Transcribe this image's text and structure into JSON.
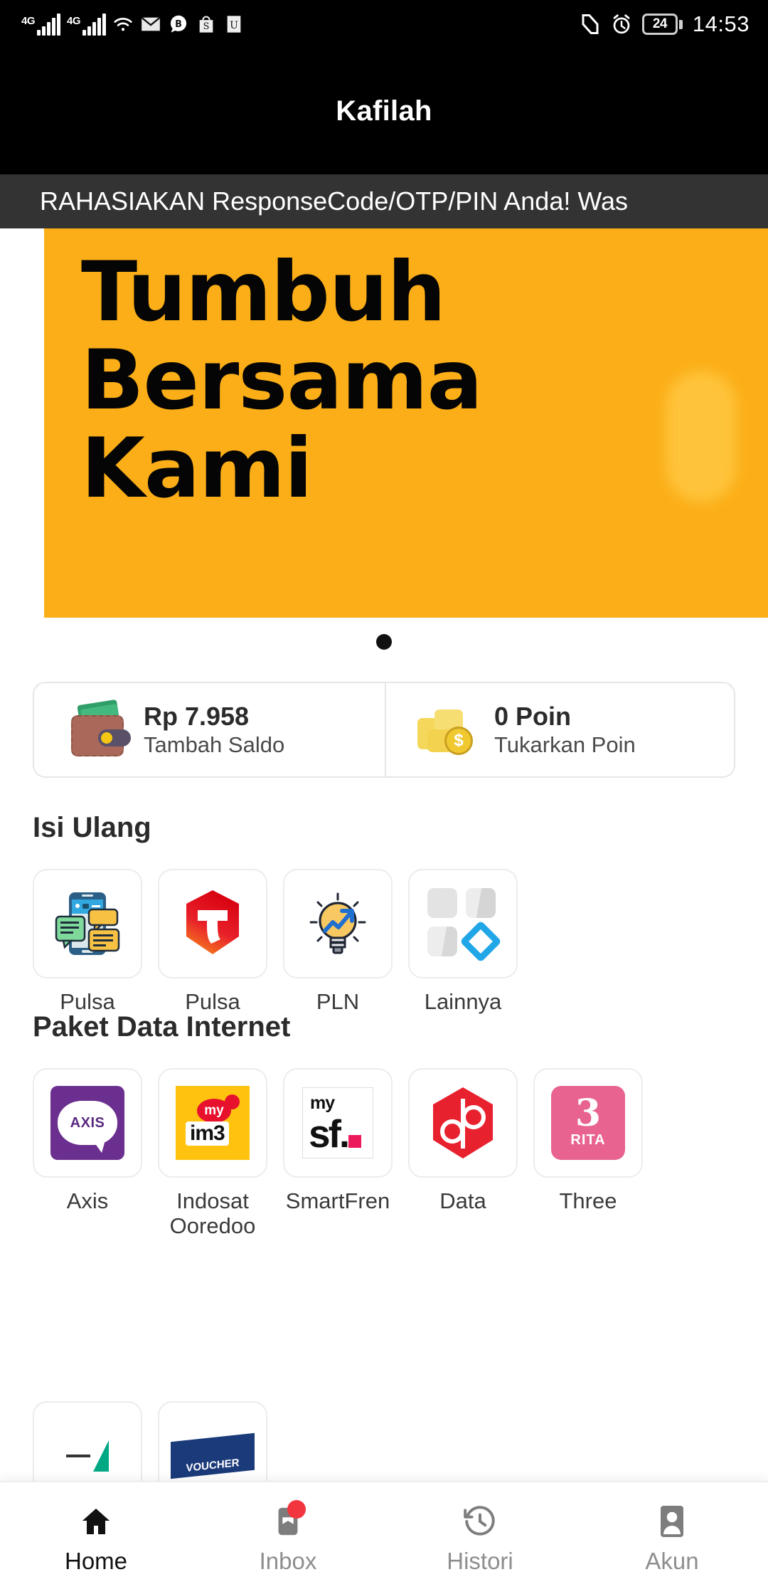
{
  "status_bar": {
    "network_1": "4G",
    "network_2": "4G",
    "icons": [
      "signal-4g-icon",
      "signal-4g-icon",
      "wifi-icon",
      "mail-icon",
      "blibli-icon",
      "shopee-icon",
      "app-icon"
    ],
    "nfc_icon": "nfc-icon",
    "alarm_icon": "alarm-icon",
    "battery_percent": "24",
    "time": "14:53"
  },
  "app_bar": {
    "title": "Kafilah"
  },
  "marquee": {
    "text": "RAHASIAKAN ResponseCode/OTP/PIN Anda! Was"
  },
  "banner": {
    "line1": "Tumbuh",
    "line2": "Bersama",
    "line3": "Kami",
    "background_color": "#FBAE17",
    "text_color": "#050505",
    "carousel_dots": 1,
    "active_dot": 0
  },
  "balance_card": {
    "saldo": {
      "amount": "Rp 7.958",
      "action": "Tambah Saldo",
      "icon": "wallet-icon"
    },
    "poin": {
      "amount": "0 Poin",
      "action": "Tukarkan Poin",
      "icon": "coins-icon"
    }
  },
  "isi_ulang": {
    "title": "Isi Ulang",
    "items": [
      {
        "label": "Pulsa",
        "icon": "phone-chat-icon"
      },
      {
        "label": "Pulsa",
        "icon": "telkomsel-icon"
      },
      {
        "label": "PLN",
        "icon": "lightbulb-chart-icon"
      },
      {
        "label": "Lainnya",
        "icon": "grid-more-icon"
      }
    ]
  },
  "paket_data": {
    "title": "Paket Data Internet",
    "items": [
      {
        "label": "Axis",
        "icon": "axis-logo"
      },
      {
        "label": "Indosat Ooredoo",
        "icon": "indosat-im3-logo"
      },
      {
        "label": "SmartFren",
        "icon": "smartfren-logo"
      },
      {
        "label": "Data",
        "icon": "data-hexagon-logo"
      },
      {
        "label": "Three",
        "icon": "three-rita-logo"
      }
    ]
  },
  "partial_row": {
    "items": [
      {
        "icon": "green-triangle-icon"
      },
      {
        "icon": "voucher-icon",
        "label": "VOUCHER"
      }
    ]
  },
  "bottom_nav": {
    "active": "Home",
    "items": [
      {
        "label": "Home",
        "icon": "home-icon",
        "badge": false
      },
      {
        "label": "Inbox",
        "icon": "inbox-icon",
        "badge": true
      },
      {
        "label": "Histori",
        "icon": "history-icon",
        "badge": false
      },
      {
        "label": "Akun",
        "icon": "account-icon",
        "badge": false
      }
    ]
  }
}
